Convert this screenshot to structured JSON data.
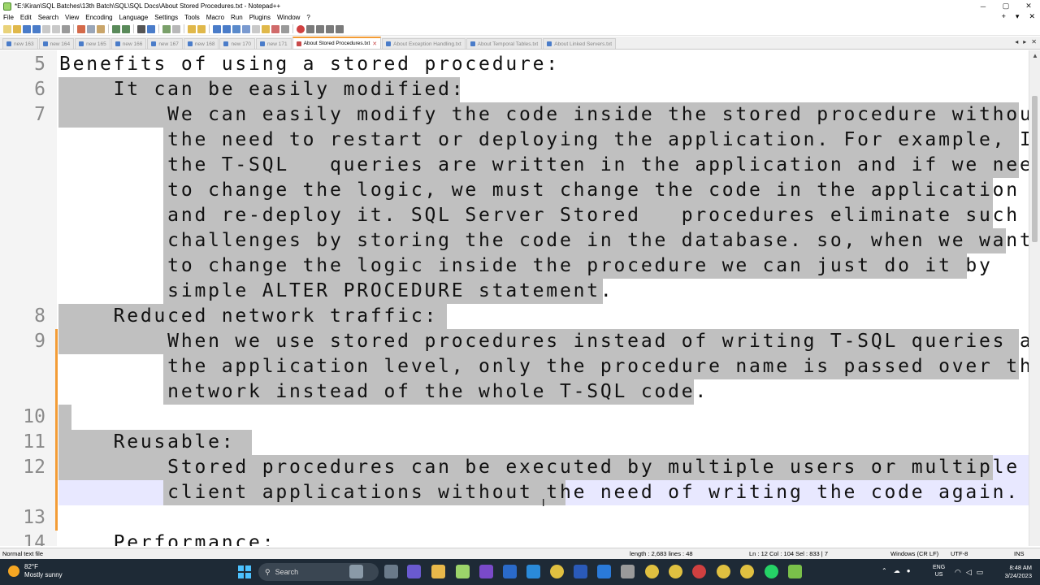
{
  "window": {
    "title": "*E:\\Kiran\\SQL Batches\\13th Batch\\SQL\\SQL Docs\\About Stored Procedures.txt - Notepad++",
    "minimize": "─",
    "maximize": "▢",
    "close": "✕"
  },
  "menu": [
    "File",
    "Edit",
    "Search",
    "View",
    "Encoding",
    "Language",
    "Settings",
    "Tools",
    "Macro",
    "Run",
    "Plugins",
    "Window",
    "?"
  ],
  "menu_right": [
    "+",
    "▾",
    "✕"
  ],
  "tabs": [
    {
      "label": "new 163"
    },
    {
      "label": "new 164"
    },
    {
      "label": "new 165"
    },
    {
      "label": "new 166"
    },
    {
      "label": "new 167"
    },
    {
      "label": "new 168"
    },
    {
      "label": "new 170"
    },
    {
      "label": "new 171"
    },
    {
      "label": "About Stored Procedures.txt",
      "active": true,
      "close": "✕"
    },
    {
      "label": "About Exception Handling.txt"
    },
    {
      "label": "About Temporal Tables.txt"
    },
    {
      "label": "About Linked Servers.txt"
    }
  ],
  "tab_arrows": [
    "◂",
    "▸",
    "✕"
  ],
  "editor": {
    "lines": [
      {
        "num": "5",
        "text": "Benefits of using a stored procedure:"
      },
      {
        "num": "6",
        "text": "    It can be easily modified:"
      },
      {
        "num": "7",
        "text": "        We can easily modify the code inside the stored procedure without"
      },
      {
        "num": "",
        "text": "        the need to restart or deploying the application. For example, If"
      },
      {
        "num": "",
        "text": "        the T-SQL   queries are written in the application and if we need"
      },
      {
        "num": "",
        "text": "        to change the logic, we must change the code in the application"
      },
      {
        "num": "",
        "text": "        and re-deploy it. SQL Server Stored   procedures eliminate such"
      },
      {
        "num": "",
        "text": "        challenges by storing the code in the database. so, when we want"
      },
      {
        "num": "",
        "text": "        to change the logic inside the procedure we can just do it by"
      },
      {
        "num": "",
        "text": "        simple ALTER PROCEDURE statement."
      },
      {
        "num": "8",
        "text": "    Reduced network traffic:"
      },
      {
        "num": "9",
        "text": "        When we use stored procedures instead of writing T-SQL queries at"
      },
      {
        "num": "",
        "text": "        the application level, only the procedure name is passed over the"
      },
      {
        "num": "",
        "text": "        network instead of the whole T-SQL code."
      },
      {
        "num": "10",
        "text": ""
      },
      {
        "num": "11",
        "text": "    Reusable:"
      },
      {
        "num": "12",
        "text": "        Stored procedures can be executed by multiple users or multiple"
      },
      {
        "num": "",
        "text": "        client applications without the need of writing the code again."
      },
      {
        "num": "13",
        "text": ""
      },
      {
        "num": "14",
        "text": "    Performance:"
      }
    ]
  },
  "status": {
    "file_type": "Normal text file",
    "length": "length : 2,683    lines : 48",
    "position": "Ln : 12    Col : 104    Sel : 833 | 7",
    "eol": "Windows (CR LF)",
    "encoding": "UTF-8",
    "mode": "INS"
  },
  "taskbar": {
    "temp": "82°F",
    "weather": "Mostly sunny",
    "search": "Search",
    "lang_top": "ENG",
    "lang_bottom": "US",
    "time": "8:48 AM",
    "date": "3/24/2023"
  },
  "colors": {
    "selection": "#c0c0c0",
    "current_line": "#e8e8ff",
    "change_marker": "#f39c36",
    "taskbar": "#1e2a36"
  }
}
